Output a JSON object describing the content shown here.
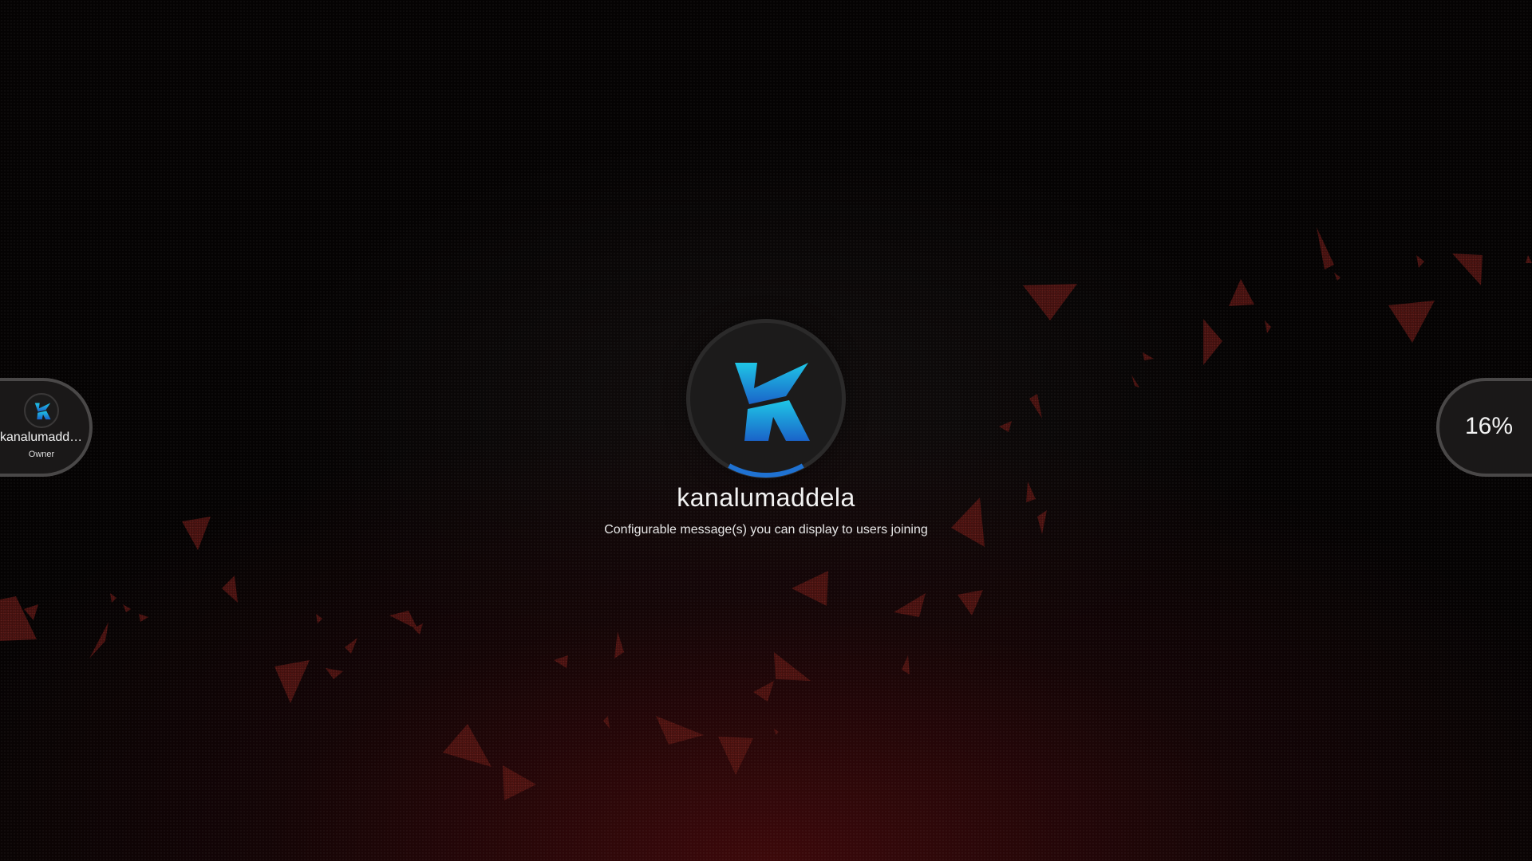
{
  "server": {
    "name": "kanalumaddela",
    "message": "Configurable message(s) you can display to users joining",
    "logo_icon": "k-logo-icon",
    "logo_gradient": [
      "#1fc6e6",
      "#1a63c9"
    ],
    "loading_progress": 0.16
  },
  "owner": {
    "name": "kanalumaddela",
    "role": "Owner"
  },
  "progress": {
    "percent_label": "16%"
  },
  "colors": {
    "background": "#050303",
    "glow": "#460a0c",
    "shard": "#5a1614",
    "pill_border": "#4a4848",
    "progress_arc": "#1f72d2"
  }
}
